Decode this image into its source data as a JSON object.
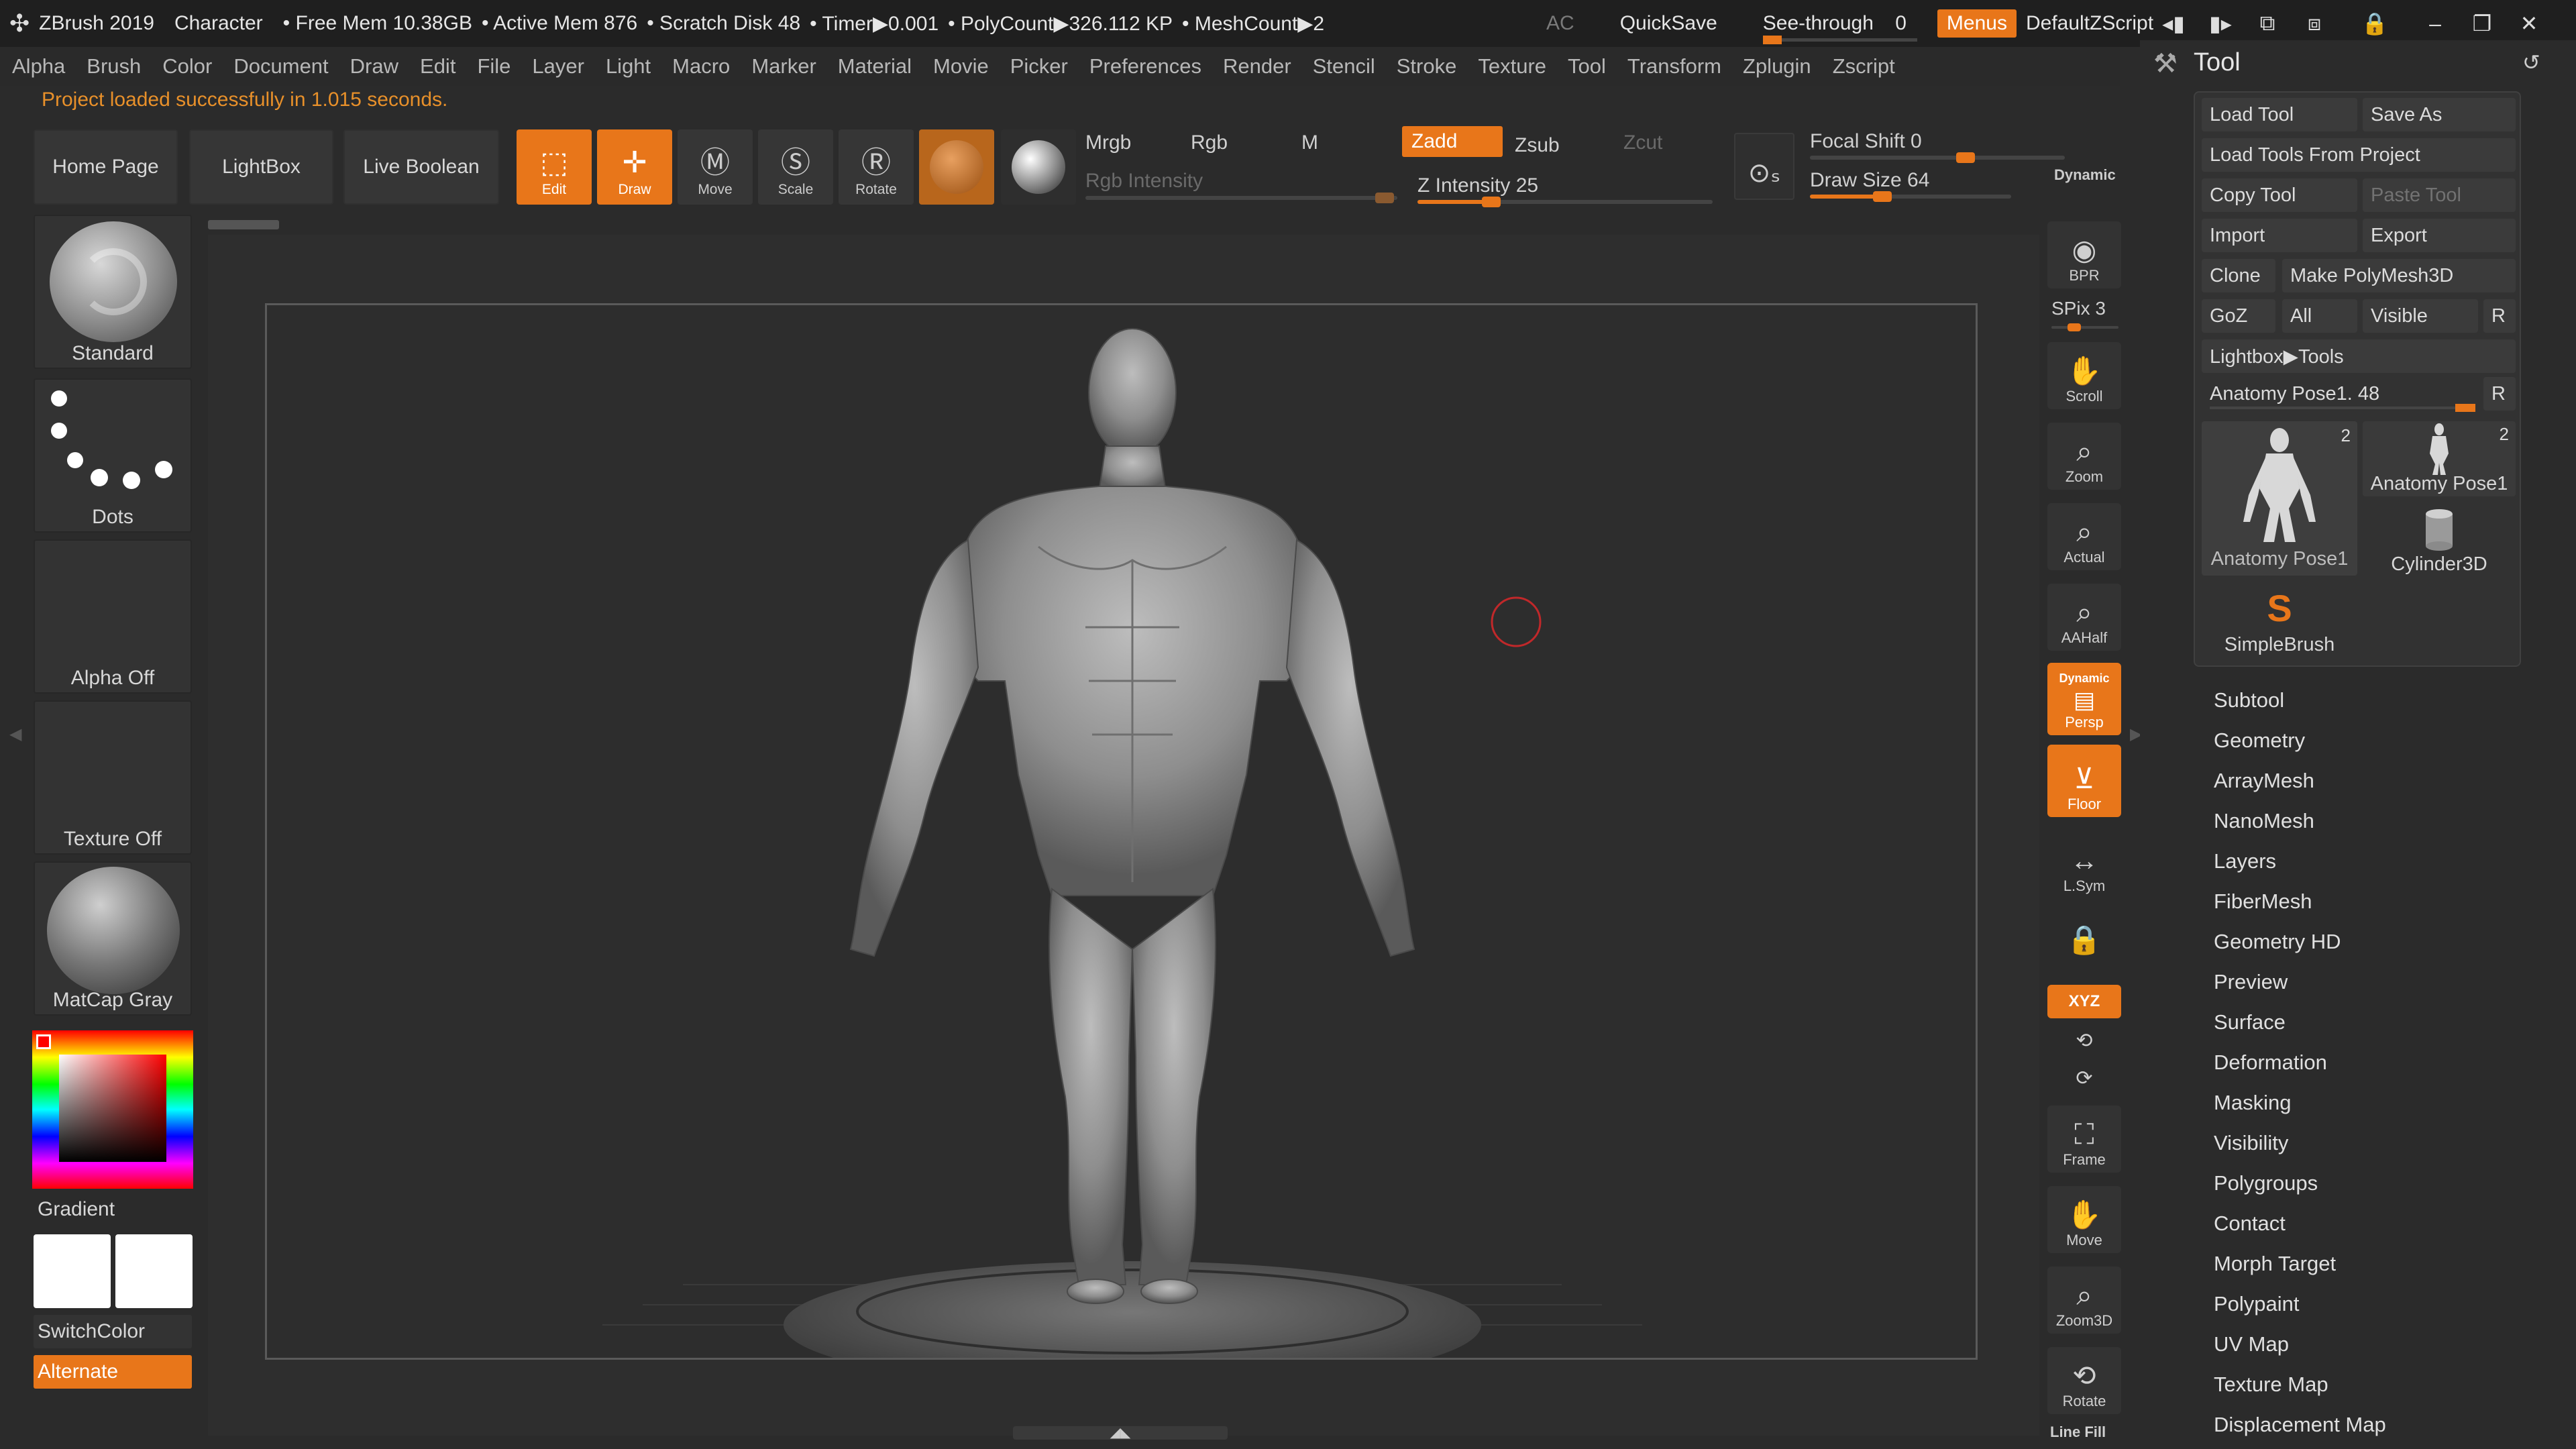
{
  "titlebar": {
    "app": "ZBrush 2019",
    "project": "Character",
    "free_mem": "• Free Mem 10.38GB",
    "active_mem": "• Active Mem 876",
    "scratch": "• Scratch Disk 48",
    "timer": "• Timer▶0.001",
    "polycount": "• PolyCount▶326.112 KP",
    "meshcount": "• MeshCount▶2",
    "ac": "AC",
    "quicksave": "QuickSave",
    "seethrough": "See-through",
    "seethrough_value": "0",
    "menus": "Menus",
    "zscript": "DefaultZScript"
  },
  "menubar": [
    "Alpha",
    "Brush",
    "Color",
    "Document",
    "Draw",
    "Edit",
    "File",
    "Layer",
    "Light",
    "Macro",
    "Marker",
    "Material",
    "Movie",
    "Picker",
    "Preferences",
    "Render",
    "Stencil",
    "Stroke",
    "Texture",
    "Tool",
    "Transform",
    "Zplugin",
    "Zscript"
  ],
  "status": "Project loaded successfully in 1.015 seconds.",
  "shelf": {
    "home": "Home Page",
    "lightbox": "LightBox",
    "liveboolean": "Live Boolean",
    "edit": "Edit",
    "draw": "Draw",
    "move": "Move",
    "scale": "Scale",
    "rotate": "Rotate",
    "mrgb": "Mrgb",
    "rgb": "Rgb",
    "m": "M",
    "zadd": "Zadd",
    "zsub": "Zsub",
    "zcut": "Zcut",
    "rgb_intensity": "Rgb Intensity",
    "z_intensity": "Z Intensity 25",
    "focal_shift": "Focal Shift 0",
    "draw_size": "Draw Size 64",
    "dynamic": "Dynamic",
    "z_intensity_value": 25,
    "draw_size_value": 64
  },
  "left": {
    "brush": "Standard",
    "stroke": "Dots",
    "alpha": "Alpha Off",
    "texture": "Texture Off",
    "material": "MatCap Gray",
    "gradient": "Gradient",
    "switchcolor": "SwitchColor",
    "alternate": "Alternate"
  },
  "right_shelf": {
    "bpr": "BPR",
    "spix": "SPix 3",
    "scroll": "Scroll",
    "zoom": "Zoom",
    "actual": "Actual",
    "aahalf": "AAHalf",
    "dynamic": "Dynamic",
    "persp": "Persp",
    "floor": "Floor",
    "lsym": "L.Sym",
    "xyz": "XYZ",
    "frame": "Frame",
    "move": "Move",
    "zoom3d": "Zoom3D",
    "rotate": "Rotate",
    "linefill": "Line Fill"
  },
  "toolpanel": {
    "title": "Tool",
    "load_tool": "Load Tool",
    "save_as": "Save As",
    "load_from_project": "Load Tools From Project",
    "copy_tool": "Copy Tool",
    "paste_tool": "Paste Tool",
    "import": "Import",
    "export": "Export",
    "clone": "Clone",
    "make_polymesh": "Make PolyMesh3D",
    "goz": "GoZ",
    "all": "All",
    "visible": "Visible",
    "r": "R",
    "lightbox_tools": "Lightbox▶Tools",
    "current_tool": "Anatomy Pose1. 48",
    "thumb_main": "Anatomy Pose1",
    "thumb_main_count": "2",
    "thumb_small": "Anatomy Pose1",
    "thumb_small_count": "2",
    "cylinder": "Cylinder3D",
    "simplebrush": "SimpleBrush",
    "subpalettes": [
      "Subtool",
      "Geometry",
      "ArrayMesh",
      "NanoMesh",
      "Layers",
      "FiberMesh",
      "Geometry HD",
      "Preview",
      "Surface",
      "Deformation",
      "Masking",
      "Visibility",
      "Polygroups",
      "Contact",
      "Morph Target",
      "Polypaint",
      "UV Map",
      "Texture Map",
      "Displacement Map"
    ]
  },
  "colors": {
    "accent": "#e8761a",
    "background": "#2b2b2b",
    "canvas": "#2d2d2d"
  }
}
